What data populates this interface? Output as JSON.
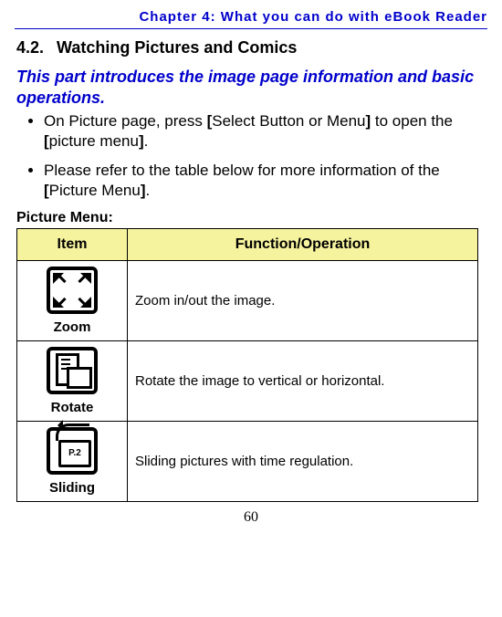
{
  "header": "Chapter 4: What you can do with eBook Reader",
  "section_number": "4.2.",
  "section_title": "Watching Pictures and Comics",
  "intro": "This part introduces the image page information and basic operations.",
  "bullets": [
    {
      "prefix": "On Picture page, press ",
      "b1o": "[",
      "t1": "Select Button or Menu",
      "b1c": "]",
      "mid": " to open the ",
      "b2o": "[",
      "t2": "picture menu",
      "b2c": "]",
      "suffix": "."
    },
    {
      "prefix": "Please refer to the table below for more information of the ",
      "b1o": "[",
      "t1": "Picture Menu",
      "b1c": "]",
      "mid": "",
      "b2o": "",
      "t2": "",
      "b2c": "",
      "suffix": "."
    }
  ],
  "picture_menu_label": "Picture Menu:",
  "table": {
    "headers": {
      "item": "Item",
      "func": "Function/Operation"
    },
    "rows": [
      {
        "name": "Zoom",
        "desc": "Zoom in/out the image."
      },
      {
        "name": "Rotate",
        "desc": "Rotate the image to vertical or horizontal."
      },
      {
        "name": "Sliding",
        "desc": "Sliding pictures with time regulation."
      }
    ]
  },
  "sliding_text": "P.2",
  "page_number": "60"
}
